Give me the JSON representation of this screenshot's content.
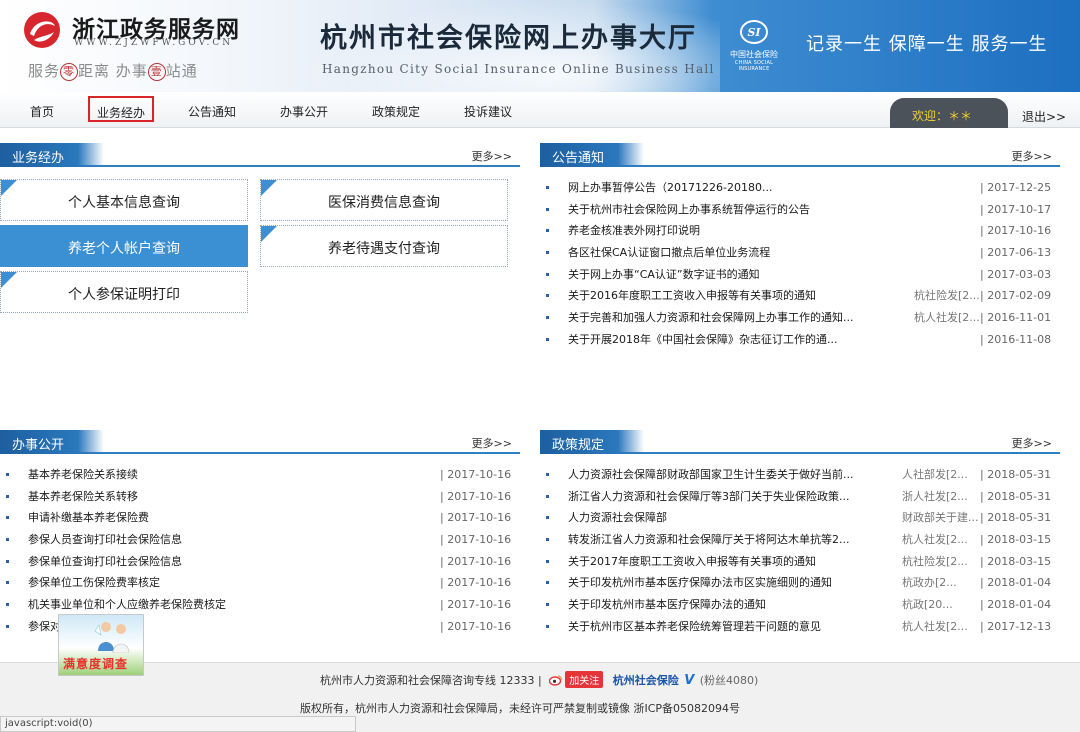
{
  "header": {
    "zj_title": "浙江政务服务网",
    "zj_url": "WWW.ZJZWFW.GOV.CN",
    "zj_slogan": {
      "a": "服务",
      "b": "零",
      "c": "距离  办事",
      "d": "壹",
      "e": "站通"
    },
    "hz_title": "杭州市社会保险网上办事大厅",
    "hz_subtitle": "Hangzhou City Social Insurance Online Business Hall",
    "si_logo": {
      "cn": "中国社会保险",
      "en": "CHINA SOCIAL INSURANCE"
    },
    "slogan_right": "记录一生  保障一生  服务一生"
  },
  "nav": {
    "items": [
      "首页",
      "业务经办",
      "公告通知",
      "办事公开",
      "政策规定",
      "投诉建议"
    ],
    "active": "业务经办",
    "welcome": "欢迎：＊＊",
    "logout": "退出>>"
  },
  "business": {
    "title": "业务经办",
    "more": "更多>>",
    "tiles": [
      "个人基本信息查询",
      "医保消费信息查询",
      "养老个人帐户查询",
      "养老待遇支付查询",
      "个人参保证明打印"
    ]
  },
  "notices": {
    "title": "公告通知",
    "more": "更多>>",
    "items": [
      {
        "title": "网上办事暂停公告（20171226-20180...",
        "source": "",
        "date": "| 2017-12-25"
      },
      {
        "title": "关于杭州市社会保险网上办事系统暂停运行的公告",
        "source": "",
        "date": "| 2017-10-17"
      },
      {
        "title": "养老金核准表外网打印说明",
        "source": "",
        "date": "| 2017-10-16"
      },
      {
        "title": "各区社保CA认证窗口撤点后单位业务流程",
        "source": "",
        "date": "| 2017-06-13"
      },
      {
        "title": "关于网上办事“CA认证”数字证书的通知",
        "source": "",
        "date": "| 2017-03-03"
      },
      {
        "title": "关于2016年度职工工资收入申报等有关事项的通知",
        "source": "杭社险发[2...",
        "date": "| 2017-02-09"
      },
      {
        "title": "关于完善和加强人力资源和社会保障网上办事工作的通知...",
        "source": "杭人社发[2...",
        "date": "| 2016-11-01"
      },
      {
        "title": "关于开展2018年《中国社会保障》杂志征订工作的通...",
        "source": "",
        "date": "| 2016-11-08"
      }
    ]
  },
  "public_affairs": {
    "title": "办事公开",
    "more": "更多>>",
    "items": [
      {
        "title": "基本养老保险关系接续",
        "date": "| 2017-10-16"
      },
      {
        "title": "基本养老保险关系转移",
        "date": "| 2017-10-16"
      },
      {
        "title": "申请补缴基本养老保险费",
        "date": "| 2017-10-16"
      },
      {
        "title": "参保人员查询打印社会保险信息",
        "date": "| 2017-10-16"
      },
      {
        "title": "参保单位查询打印社会保险信息",
        "date": "| 2017-10-16"
      },
      {
        "title": "参保单位工伤保险费率核定",
        "date": "| 2017-10-16"
      },
      {
        "title": "机关事业单位和个人应缴养老保险费核定",
        "date": "| 2017-10-16"
      },
      {
        "title": "参保对                    费核定",
        "date": "| 2017-10-16"
      }
    ]
  },
  "policies": {
    "title": "政策规定",
    "more": "更多>>",
    "items": [
      {
        "title": "人力资源社会保障部财政部国家卫生计生委关于做好当前...",
        "source": "人社部发[2...",
        "date": "| 2018-05-31"
      },
      {
        "title": "浙江省人力资源和社会保障厅等3部门关于失业保险政策...",
        "source": "浙人社发[2...",
        "date": "| 2018-05-31"
      },
      {
        "title": "人力资源社会保障部",
        "source": "财政部关于建...",
        "date": "| 2018-05-31"
      },
      {
        "title": "转发浙江省人力资源和社会保障厅关于将阿达木单抗等2...",
        "source": "杭人社发[2...",
        "date": "| 2018-03-15"
      },
      {
        "title": "关于2017年度职工工资收入申报等有关事项的通知",
        "source": "杭社险发[2...",
        "date": "| 2018-03-15"
      },
      {
        "title": "关于印发杭州市基本医疗保障办法市区实施细则的通知",
        "source": "杭政办[2...",
        "date": "| 2018-01-04"
      },
      {
        "title": "关于印发杭州市基本医疗保障办法的通知",
        "source": "杭政[20...",
        "date": "| 2018-01-04"
      },
      {
        "title": "关于杭州市区基本养老保险统筹管理若干问题的意见",
        "source": "杭人社发[2...",
        "date": "| 2017-12-13"
      }
    ]
  },
  "footer": {
    "hotline": "杭州市人力资源和社会保障咨询专线 12333 |",
    "follow": "加关注",
    "weibo_name": "杭州社会保险",
    "verified": "V",
    "fans": "(粉丝4080)",
    "copyright": "版权所有，杭州市人力资源和社会保障局，未经许可严禁复制或镜像 浙ICP备05082094号",
    "status": "javascript:void(0)"
  },
  "survey": {
    "label": "满意度调查"
  },
  "colors": {
    "accent": "#2f7fc4",
    "active_tile": "#3b8fd3",
    "highlight": "#d9252a",
    "welcome_text": "#f2d22a"
  }
}
